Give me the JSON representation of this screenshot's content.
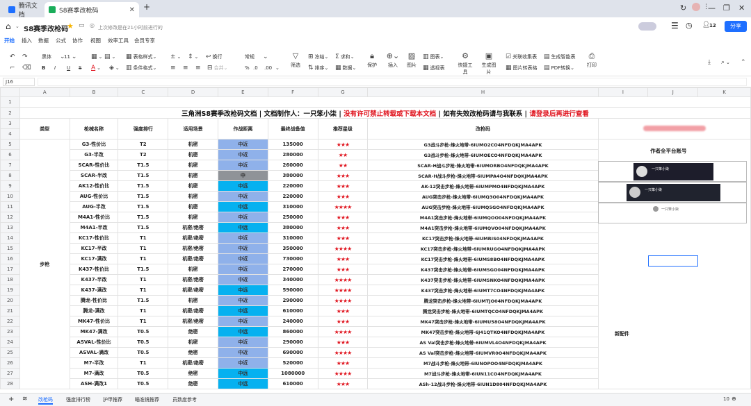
{
  "browser": {
    "tabs": [
      {
        "label": "腾讯文档"
      },
      {
        "label": "S8赛季改枪码"
      }
    ]
  },
  "doc": {
    "title": "S8赛季改枪码",
    "save_status": "上次修改是在21小时前进行的",
    "share": "分享",
    "collab_count": "12"
  },
  "menu": [
    "开始",
    "插入",
    "数据",
    "公式",
    "协作",
    "视图",
    "效率工具",
    "会员专享"
  ],
  "ribbon": {
    "font": "黑体",
    "font_size": "11",
    "number_format": "常规",
    "table_style": "表格样式",
    "cond_format": "条件格式",
    "wrap": "换行",
    "merge": "合并",
    "filter": "筛选",
    "sort": "排序",
    "freeze": "冻结",
    "data": "数据",
    "sum": "求和",
    "protect": "保护",
    "insert": "插入",
    "image": "图片",
    "chart": "图表",
    "pivot": "透视表",
    "quick": "快捷工具",
    "gen_image": "生成图片",
    "link_form": "关联收集表",
    "smart_form": "生成智能表",
    "image_to_table": "图片转表格",
    "pdf": "PDF转换",
    "print": "打印",
    "percent": "%"
  },
  "namebox": "J16",
  "columns": [
    "A",
    "B",
    "C",
    "D",
    "E",
    "F",
    "G",
    "H",
    "I",
    "J",
    "K"
  ],
  "title_parts": [
    {
      "text": "三角洲S8赛季改枪码文档 | 文档制作人：一只笨小柒 | ",
      "color": "black"
    },
    {
      "text": "没有许可禁止转载或下载本文档",
      "color": "red"
    },
    {
      "text": " | 如有失效改枪码请与我联系 | ",
      "color": "black"
    },
    {
      "text": "请登录后再进行查看",
      "color": "red"
    }
  ],
  "headers": {
    "type": "类型",
    "name": "枪械名称",
    "rank": "强度排行",
    "scene": "适用场景",
    "range": "作战距离",
    "cost": "最终战备值",
    "stars": "推荐星级",
    "code": "改枪码"
  },
  "category": "步枪",
  "side": {
    "author": "作者全平台账号",
    "note": "新配件",
    "card1": "一只笨小柒",
    "card2": "一只笨小柒",
    "card3": "一只笨小柒"
  },
  "rows": [
    {
      "n": "5",
      "name": "G3-性价比",
      "rank": "T2",
      "scene": "机密",
      "range": "中近",
      "rc": "lblue",
      "cost": "135000",
      "stars": "★★★",
      "code": "G3战斗步枪-烽火地带-6IUMO2CO4NFDQKJMA4APK"
    },
    {
      "n": "6",
      "name": "G3-半改",
      "rank": "T2",
      "scene": "机密",
      "range": "中近",
      "rc": "lblue",
      "cost": "280000",
      "stars": "★★",
      "code": "G3战斗步枪-烽火地带-6IUMOECO4NFDQKJMA4APK"
    },
    {
      "n": "7",
      "name": "SCAR-性价比",
      "rank": "T1.5",
      "scene": "机密",
      "range": "中近",
      "rc": "lblue",
      "cost": "260000",
      "stars": "★★",
      "code": "SCAR-H战斗步枪-烽火地带-6IUMORBO4NFDQKJMA4APK"
    },
    {
      "n": "8",
      "name": "SCAR-半改",
      "rank": "T1.5",
      "scene": "机密",
      "range": "中",
      "rc": "grey",
      "cost": "380000",
      "stars": "★★★",
      "code": "SCAR-H战斗步枪-烽火地带-6IUMPA4O4NFDQKJMA4APK"
    },
    {
      "n": "9",
      "name": "AK12-性价比",
      "rank": "T1.5",
      "scene": "机密",
      "range": "中远",
      "rc": "blue",
      "cost": "220000",
      "stars": "★★★",
      "code": "AK-12突击步枪-烽火地带-6IUMPMO4NFDQKJMA4APK"
    },
    {
      "n": "10",
      "name": "AUG-性价比",
      "rank": "T1.5",
      "scene": "机密",
      "range": "中近",
      "rc": "lblue",
      "cost": "220000",
      "stars": "★★★",
      "code": "AUG突击步枪-烽火地带-6IUMQ3O04NFDQKJMA4APK"
    },
    {
      "n": "11",
      "name": "AUG-半改",
      "rank": "T1.5",
      "scene": "机密",
      "range": "中远",
      "rc": "blue",
      "cost": "310000",
      "stars": "★★★★",
      "code": "AUG突击步枪-烽火地带-6IUMQ5GO4NFDQKJMA4APK"
    },
    {
      "n": "12",
      "name": "M4A1-性价比",
      "rank": "T1.5",
      "scene": "机密",
      "range": "中近",
      "rc": "lblue",
      "cost": "250000",
      "stars": "★★★",
      "code": "M4A1突击步枪-烽火地带-6IUMQOO04NFDQKJMA4APK"
    },
    {
      "n": "13",
      "name": "M4A1-半改",
      "rank": "T1.5",
      "scene": "机密/绝密",
      "range": "中远",
      "rc": "blue",
      "cost": "380000",
      "stars": "★★★",
      "code": "M4A1突击步枪-烽火地带-6IUMQVO04NFDQKJMA4APK"
    },
    {
      "n": "14",
      "name": "KC17-性价比",
      "rank": "T1",
      "scene": "机密/绝密",
      "range": "中近",
      "rc": "lblue",
      "cost": "310000",
      "stars": "★★★",
      "code": "KC17突击步枪-烽火地带-6IUMRIS04NFDQKJMA4APK"
    },
    {
      "n": "15",
      "name": "KC17-半改",
      "rank": "T1",
      "scene": "机密/绝密",
      "range": "中近",
      "rc": "lblue",
      "cost": "350000",
      "stars": "★★★★",
      "code": "KC17突击步枪-烽火地带-6IUMRUGO4NFDQKJMA4APK"
    },
    {
      "n": "16",
      "name": "KC17-满改",
      "rank": "T1",
      "scene": "机密/绝密",
      "range": "中近",
      "rc": "lblue",
      "cost": "730000",
      "stars": "★★★",
      "code": "KC17突击步枪-烽火地带-6IUMS8BO4NFDQKJMA4APK"
    },
    {
      "n": "17",
      "name": "K437-性价比",
      "rank": "T1.5",
      "scene": "机密",
      "range": "中近",
      "rc": "lblue",
      "cost": "270000",
      "stars": "★★★",
      "code": "K437突击步枪-烽火地带-6IUMSGO04NFDQKJMA4APK"
    },
    {
      "n": "18",
      "name": "K437-半改",
      "rank": "T1",
      "scene": "机密/绝密",
      "range": "中近",
      "rc": "lblue",
      "cost": "340000",
      "stars": "★★★★",
      "code": "K437突击步枪-烽火地带-6IUMSNKO4NFDQKJMA4APK"
    },
    {
      "n": "19",
      "name": "K437-满改",
      "rank": "T1",
      "scene": "机密/绝密",
      "range": "中远",
      "rc": "blue",
      "cost": "590000",
      "stars": "★★★★",
      "code": "K437突击步枪-烽火地带-6IUMT7CO4NFDQKJMA4APK"
    },
    {
      "n": "20",
      "name": "腾龙-性价比",
      "rank": "T1.5",
      "scene": "机密",
      "range": "中近",
      "rc": "lblue",
      "cost": "290000",
      "stars": "★★★★",
      "code": "腾龙突击步枪-烽火地带-6IUMTJO04NFDQKJMA4APK"
    },
    {
      "n": "21",
      "name": "腾龙-满改",
      "rank": "T1",
      "scene": "机密/绝密",
      "range": "中远",
      "rc": "blue",
      "cost": "610000",
      "stars": "★★★",
      "code": "腾龙突击步枪-烽火地带-6IUMTQCO4NFDQKJMA4APK"
    },
    {
      "n": "22",
      "name": "MK47-性价比",
      "rank": "T1",
      "scene": "机密/绝密",
      "range": "中近",
      "rc": "lblue",
      "cost": "240000",
      "stars": "★★★",
      "code": "MK47突击步枪-烽火地带-6IUMU58O4NFDQKJMA4APK"
    },
    {
      "n": "23",
      "name": "MK47-满改",
      "rank": "T0.5",
      "scene": "绝密",
      "range": "中远",
      "rc": "blue",
      "cost": "860000",
      "stars": "★★★★",
      "code": "MK47突击步枪-烽火地带-6J41QTKO4NFDQKJMA4APK"
    },
    {
      "n": "24",
      "name": "ASVAL-性价比",
      "rank": "T0.5",
      "scene": "机密",
      "range": "中近",
      "rc": "lblue",
      "cost": "290000",
      "stars": "★★★",
      "code": "AS Val突击步枪-烽火地带-6IUMVL4O4NFDQKJMA4APK"
    },
    {
      "n": "25",
      "name": "ASVAL-满改",
      "rank": "T0.5",
      "scene": "绝密",
      "range": "中近",
      "rc": "lblue",
      "cost": "690000",
      "stars": "★★★★",
      "code": "AS Val突击步枪-烽火地带-6IUMVR0O4NFDQKJMA4APK"
    },
    {
      "n": "26",
      "name": "M7-半改",
      "rank": "T1",
      "scene": "机密/绝密",
      "range": "中近",
      "rc": "lblue",
      "cost": "520000",
      "stars": "★★★",
      "code": "M7战斗步枪-烽火地带-6IUNOPOO4NFDQKJMA4APK"
    },
    {
      "n": "27",
      "name": "M7-满改",
      "rank": "T0.5",
      "scene": "绝密",
      "range": "中远",
      "rc": "blue",
      "cost": "1080000",
      "stars": "★★★★",
      "code": "M7战斗步枪-烽火地带-6IUN11CO4NFDQKJMA4APK"
    },
    {
      "n": "28",
      "name": "ASH-满改1",
      "rank": "T0.5",
      "scene": "绝密",
      "range": "中远",
      "rc": "blue",
      "cost": "610000",
      "stars": "★★★",
      "code": "ASh-12战斗步枪-烽火地带-6IUN1D804NFDQKJMA4APK"
    }
  ],
  "sheets": [
    "改枪码",
    "强度排行榜",
    "护甲推荐",
    "瞄准镜推荐",
    "员数度参考"
  ],
  "zoom": "10"
}
